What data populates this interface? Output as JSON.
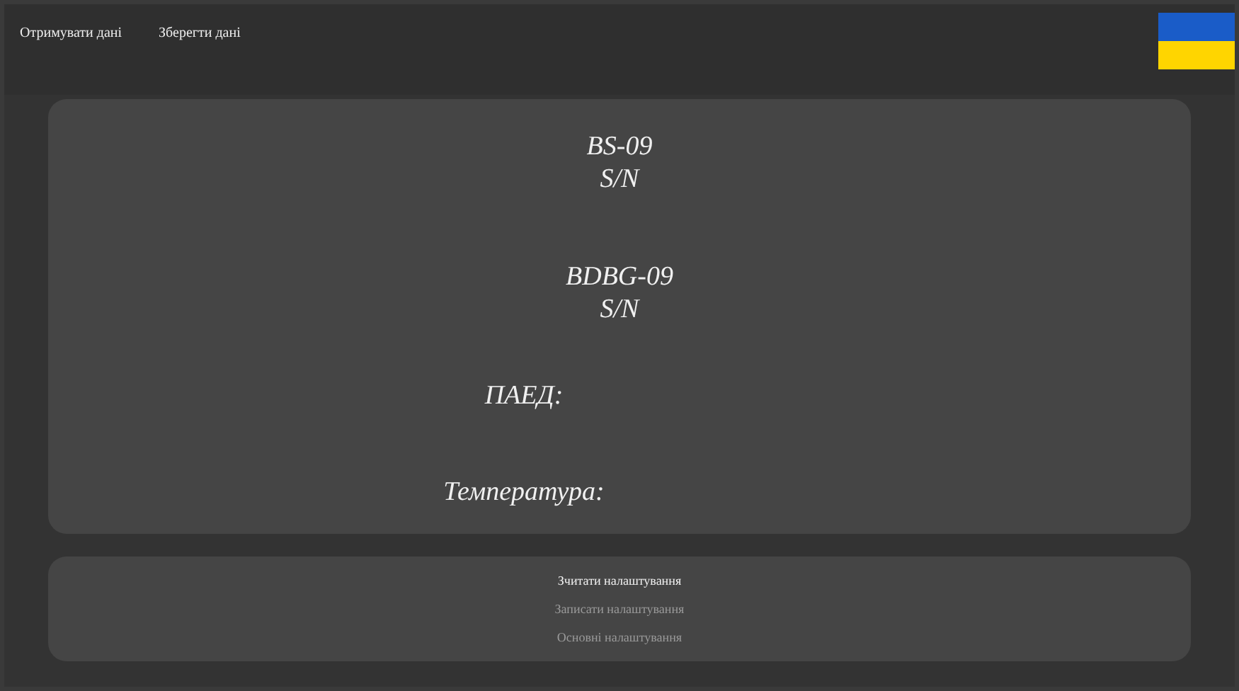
{
  "nav": [
    {
      "label": "Отримувати дані"
    },
    {
      "label": "Зберегти дані"
    }
  ],
  "devices": [
    {
      "name": "BS-09",
      "sn": "S/N"
    },
    {
      "name": "BDBG-09",
      "sn": "S/N"
    }
  ],
  "readings": [
    {
      "label": "ПАЕД:"
    },
    {
      "label": "Температура:"
    }
  ],
  "settings_menu": [
    {
      "label": "Зчитати налаштування",
      "selected": true
    },
    {
      "label": "Записати налаштування",
      "selected": false
    },
    {
      "label": "Основні налаштування",
      "selected": false
    }
  ]
}
